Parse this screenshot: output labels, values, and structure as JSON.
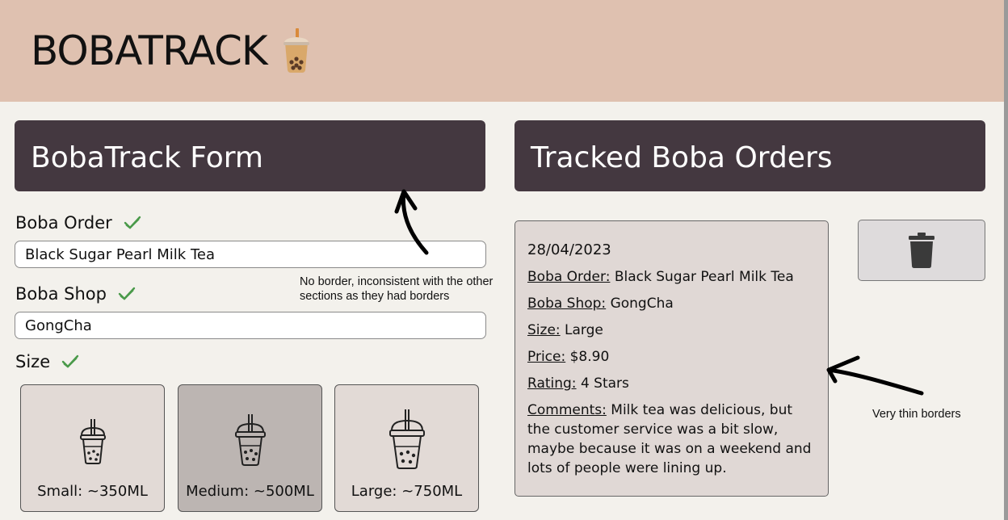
{
  "header": {
    "title": "BOBATRACK",
    "logo_icon": "boba-cup-icon"
  },
  "form": {
    "heading": "BobaTrack Form",
    "order": {
      "label": "Boba Order",
      "value": "Black Sugar Pearl Milk Tea",
      "valid_icon": "checkmark-icon"
    },
    "shop": {
      "label": "Boba Shop",
      "value": "GongCha",
      "valid_icon": "checkmark-icon"
    },
    "size": {
      "label": "Size",
      "valid_icon": "checkmark-icon",
      "options": [
        {
          "label": "Small: ~350ML",
          "selected": false
        },
        {
          "label": "Medium: ~500ML",
          "selected": true
        },
        {
          "label": "Large: ~750ML",
          "selected": false
        }
      ]
    }
  },
  "orders": {
    "heading": "Tracked Boba Orders",
    "items": [
      {
        "date": "28/04/2023",
        "order_key": "Boba Order:",
        "order_val": "Black Sugar Pearl Milk Tea",
        "shop_key": "Boba Shop:",
        "shop_val": "GongCha",
        "size_key": "Size:",
        "size_val": "Large",
        "price_key": "Price:",
        "price_val": "$8.90",
        "rating_key": "Rating:",
        "rating_val": "4 Stars",
        "comments_key": "Comments:",
        "comments_val": "Milk tea was delicious, but the customer service was a bit slow, maybe because it was on a weekend and lots of people were lining up."
      }
    ],
    "delete_icon": "trash-icon"
  },
  "annotations": {
    "note_border_line1": "No border, inconsistent with the other",
    "note_border_line2": "sections as they had borders",
    "note_thin": "Very thin borders"
  },
  "colors": {
    "header_bg": "#dfc1b0",
    "panel_head_bg": "#443840",
    "page_bg": "#f3f1ec",
    "check_green": "#4a9a4a",
    "card_bg": "#e0d8d5"
  }
}
